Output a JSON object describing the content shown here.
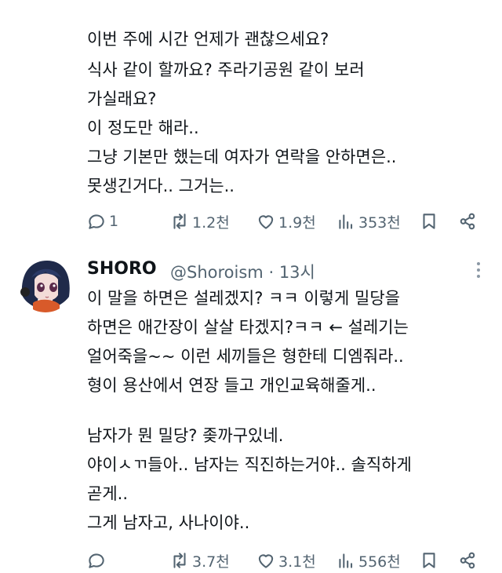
{
  "top_post": {
    "lines": [
      "이번 주에 시간 언제가 괜찮으세요?",
      "식사 같이 할까요? 주라기공원 같이 보러",
      "가실래요?",
      "이 정도만 해라..",
      "그냥 기본만 했는데 여자가 연락을 안하면은..",
      "못생긴거다.. 그거는.."
    ],
    "actions": {
      "reply_count": "1",
      "repost_count": "1.2천",
      "like_count": "1.9천",
      "views_count": "353천"
    }
  },
  "reply_post": {
    "author_name": "SHORO",
    "author_handle": "@Shoroism",
    "separator": "·",
    "time": "13시",
    "lines": [
      "이 말을 하면은 설레겠지? ㅋㅋ 이렇게 밀당을",
      "하면은 애간장이 살살 타겠지?ㅋㅋ ← 설레기는",
      "얼어죽을~~ 이런 세끼들은 형한테 디엠줘라..",
      "형이 용산에서 연장 들고 개인교육해줄게..",
      "",
      "남자가 뭔 밀당? 좆까구있네.",
      "야이ㅅㄲ들아.. 남자는 직진하는거야.. 솔직하게",
      "곧게..",
      "그게 남자고, 사나이야.."
    ],
    "actions": {
      "reply_count": "",
      "repost_count": "3.7천",
      "like_count": "3.1천",
      "views_count": "556천"
    }
  },
  "icons": {
    "reply": "reply-icon",
    "repost": "repost-icon",
    "like": "heart-icon",
    "views": "views-icon",
    "bookmark": "bookmark-icon",
    "share": "share-icon",
    "more": "more-icon"
  },
  "colors": {
    "text": "#0f1419",
    "muted": "#536471",
    "background": "#ffffff"
  }
}
